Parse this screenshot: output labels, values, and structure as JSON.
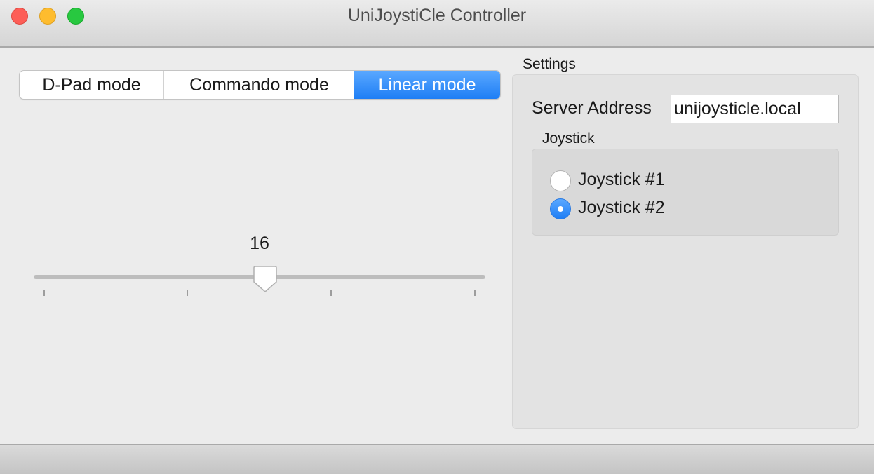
{
  "window": {
    "title": "UniJoystiCle Controller"
  },
  "modes": {
    "items": [
      {
        "label": "D-Pad mode",
        "selected": false
      },
      {
        "label": "Commando mode",
        "selected": false
      },
      {
        "label": "Linear mode",
        "selected": true
      }
    ]
  },
  "slider": {
    "value": "16"
  },
  "settings": {
    "title": "Settings",
    "server_label": "Server Address",
    "server_value": "unijoysticle.local",
    "joystick": {
      "title": "Joystick",
      "options": [
        {
          "label": "Joystick #1",
          "selected": false
        },
        {
          "label": "Joystick #2",
          "selected": true
        }
      ]
    }
  },
  "colors": {
    "accent": "#2f8cf7",
    "close": "#fd5e57",
    "minimize": "#febc2e",
    "zoom": "#28c840"
  },
  "icons": {
    "close": "close-icon",
    "minimize": "minimize-icon",
    "zoom": "zoom-icon"
  }
}
